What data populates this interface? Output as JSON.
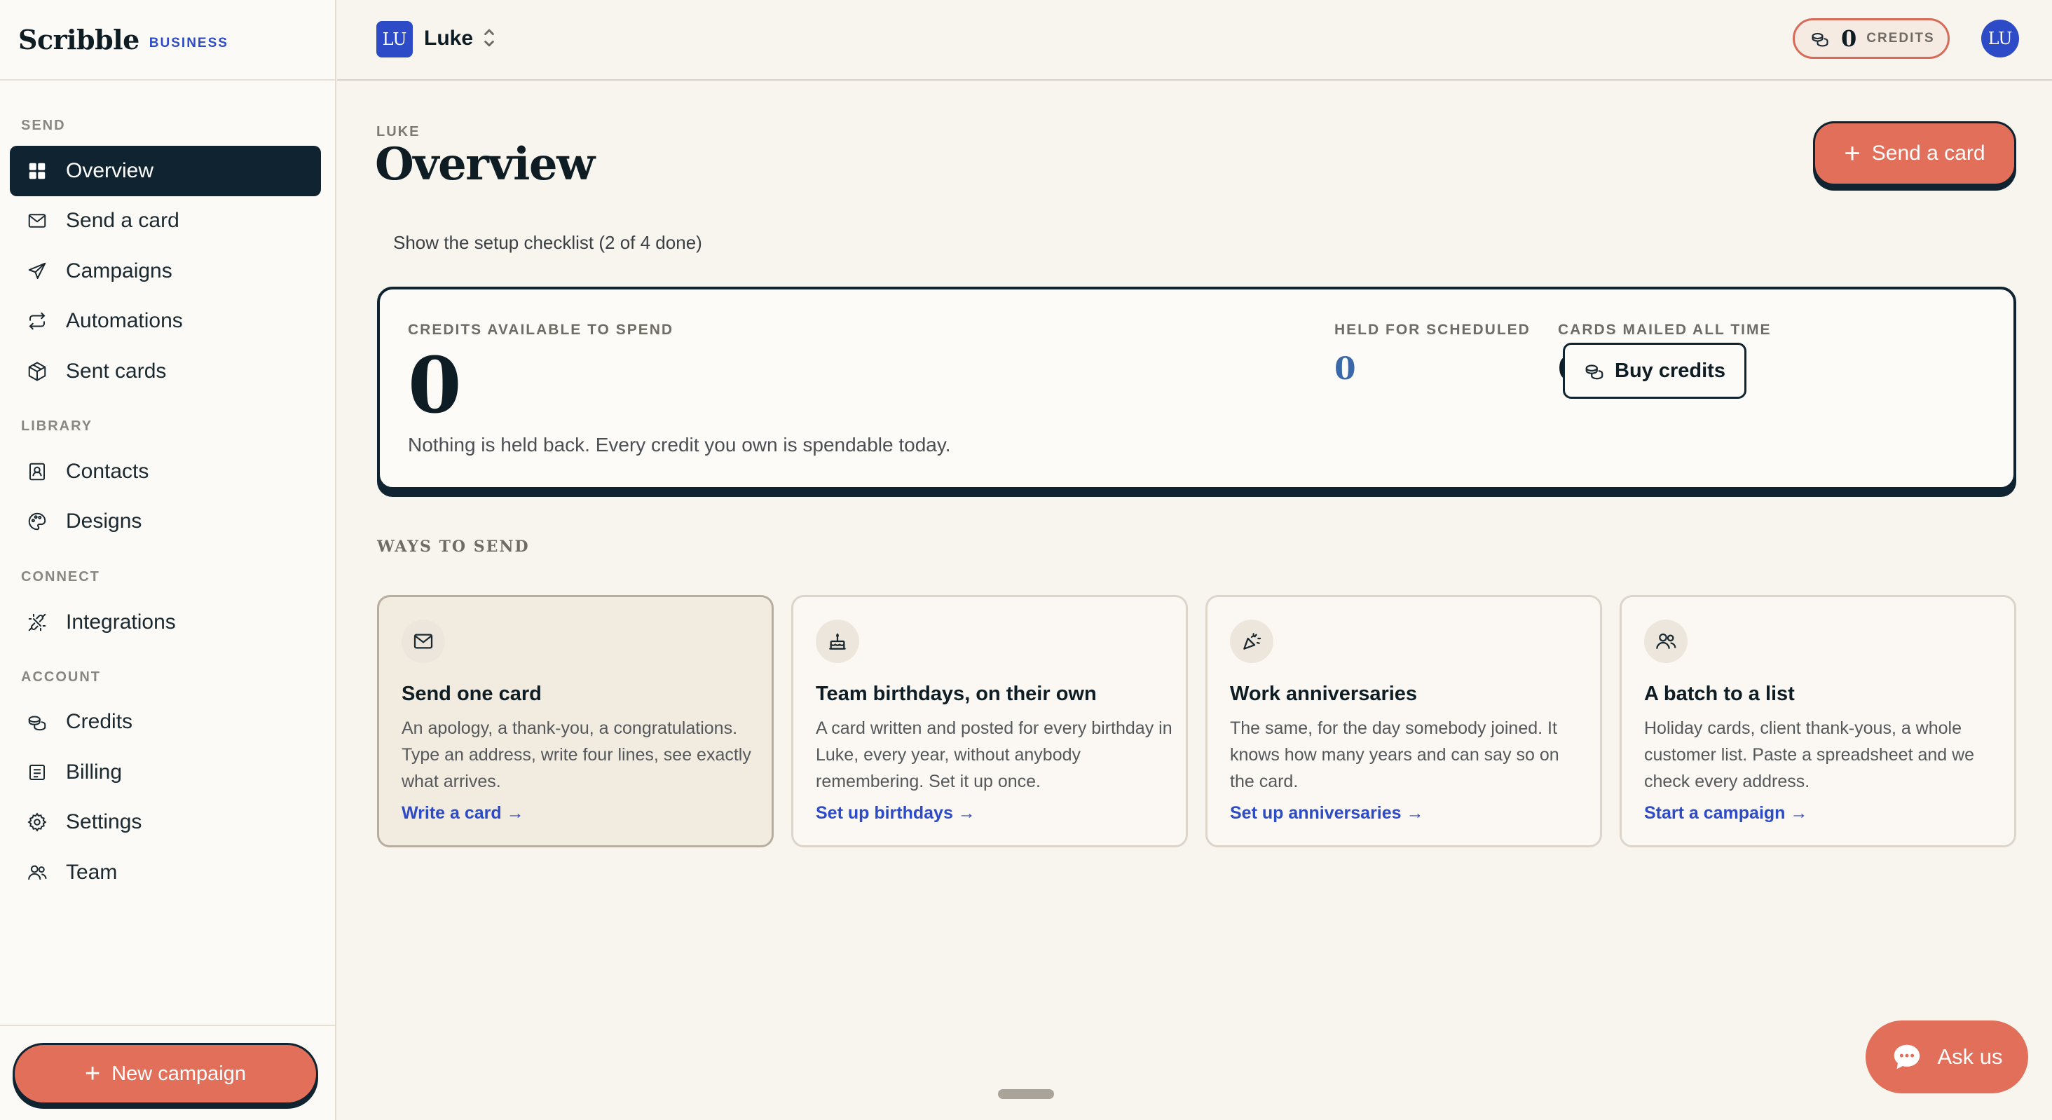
{
  "brand": {
    "name": "Scribble",
    "tag": "BUSINESS"
  },
  "sidebar": {
    "sections": {
      "send": "SEND",
      "library": "LIBRARY",
      "connect": "CONNECT",
      "account": "ACCOUNT"
    },
    "items": [
      {
        "label": "Overview",
        "icon": "grid-icon",
        "active": true
      },
      {
        "label": "Send a card",
        "icon": "envelope-icon"
      },
      {
        "label": "Campaigns",
        "icon": "paper-plane-icon"
      },
      {
        "label": "Automations",
        "icon": "repeat-icon"
      },
      {
        "label": "Sent cards",
        "icon": "box-icon"
      },
      {
        "label": "Contacts",
        "icon": "contact-book-icon"
      },
      {
        "label": "Designs",
        "icon": "palette-icon"
      },
      {
        "label": "Integrations",
        "icon": "plug-icon"
      },
      {
        "label": "Credits",
        "icon": "coins-icon"
      },
      {
        "label": "Billing",
        "icon": "receipt-icon"
      },
      {
        "label": "Settings",
        "icon": "gear-icon"
      },
      {
        "label": "Team",
        "icon": "users-icon"
      }
    ],
    "new_campaign_label": "New campaign"
  },
  "topbar": {
    "workspace_initials": "LU",
    "workspace_name": "Luke",
    "credits_count": "0",
    "credits_label": "CREDITS",
    "avatar_initials": "LU"
  },
  "main": {
    "eyebrow": "LUKE",
    "title": "Overview",
    "send_card_label": "Send a card",
    "checklist_link": "Show the setup checklist (2 of 4 done)",
    "credits_card": {
      "available_label": "CREDITS AVAILABLE TO SPEND",
      "available_value": "0",
      "note": "Nothing is held back. Every credit you own is spendable today.",
      "held_label": "HELD FOR SCHEDULED",
      "held_value": "0",
      "mailed_label": "CARDS MAILED ALL TIME",
      "mailed_value": "0",
      "buy_label": "Buy credits"
    },
    "ways_label": "WAYS TO SEND",
    "tiles": [
      {
        "icon": "envelope-icon",
        "title": "Send one card",
        "description": "An apology, a thank-you, a congratulations. Type an address, write four lines, see exactly what arrives.",
        "link": "Write a card →"
      },
      {
        "icon": "cake-icon",
        "title": "Team birthdays, on their own",
        "description": "A card written and posted for every birthday in Luke, every year, without anybody remembering. Set it up once.",
        "link": "Set up birthdays →"
      },
      {
        "icon": "party-popper-icon",
        "title": "Work anniversaries",
        "description": "The same, for the day somebody joined. It knows how many years and can say so on the card.",
        "link": "Set up anniversaries →"
      },
      {
        "icon": "users-icon",
        "title": "A batch to a list",
        "description": "Holiday cards, client thank-yous, a whole customer list. Paste a spreadsheet and we check every address.",
        "link": "Start a campaign →"
      }
    ]
  },
  "chat": {
    "label": "Ask us"
  },
  "colors": {
    "accent": "#e26f5a",
    "navy": "#0f2330",
    "link": "#2d4bc7",
    "held_value": "#3a68a8"
  }
}
